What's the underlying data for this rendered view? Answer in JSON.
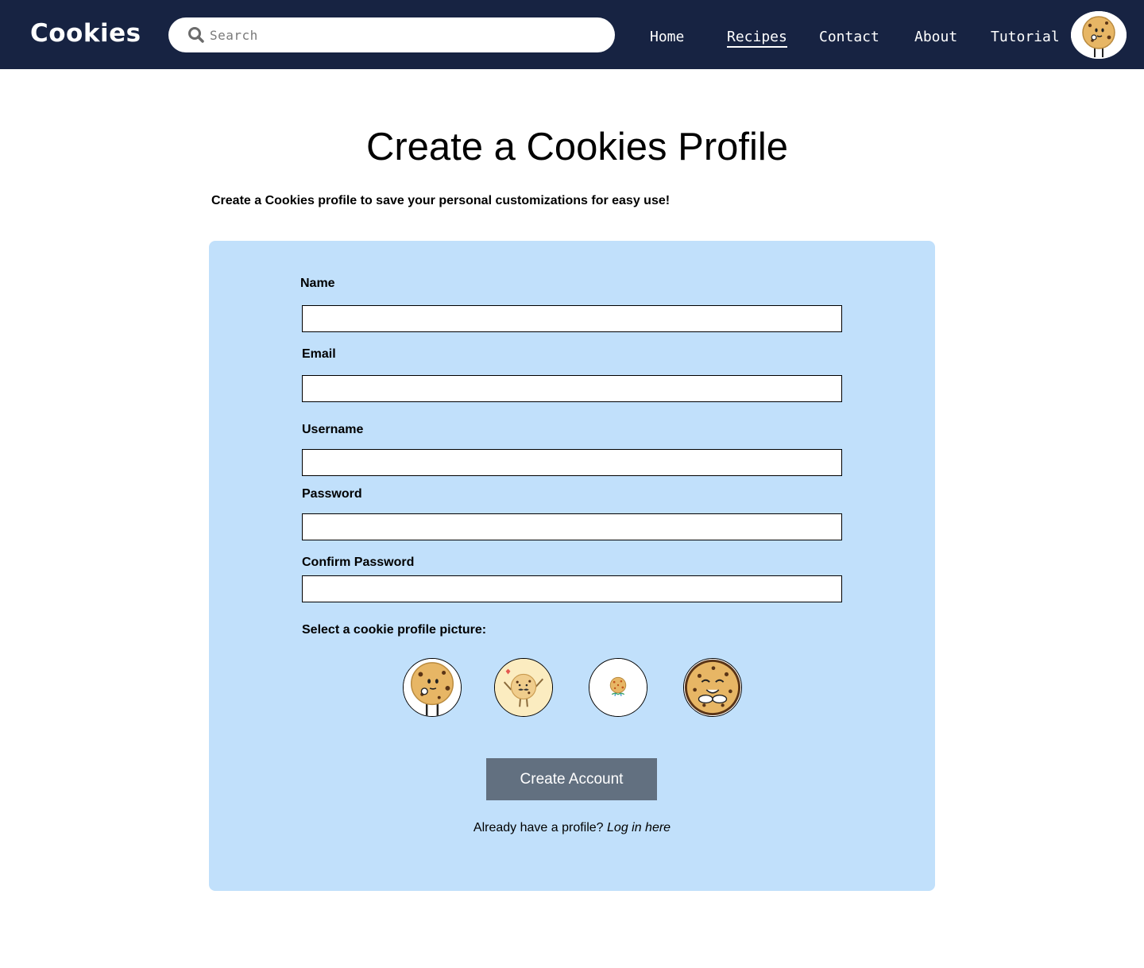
{
  "header": {
    "logo": "Cookies",
    "search": {
      "placeholder": "Search",
      "value": ""
    },
    "nav": [
      {
        "label": "Home"
      },
      {
        "label": "Recipes",
        "active": true
      },
      {
        "label": "Contact"
      },
      {
        "label": "About"
      },
      {
        "label": "Tutorial"
      }
    ],
    "avatar_icon": "cookie-character-icon"
  },
  "main": {
    "title": "Create a Cookies Profile",
    "intro": "Create a Cookies profile to save your personal customizations for easy use!",
    "form": {
      "fields": [
        {
          "label": "Name",
          "value": ""
        },
        {
          "label": "Email",
          "value": ""
        },
        {
          "label": "Username",
          "value": ""
        },
        {
          "label": "Password",
          "value": ""
        },
        {
          "label": "Confirm Password",
          "value": ""
        }
      ],
      "picture_prompt": "Select a cookie profile picture:",
      "pictures": [
        {
          "icon": "cookie-thinking-icon"
        },
        {
          "icon": "cookie-mustache-icon"
        },
        {
          "icon": "cookie-small-icon"
        },
        {
          "icon": "cookie-smiling-icon"
        }
      ],
      "submit_label": "Create Account",
      "login_prompt": "Already have a profile?",
      "login_link": "Log in here"
    }
  },
  "colors": {
    "header_bg": "#172342",
    "card_bg": "#c1e0fb",
    "button_bg": "#627080",
    "cookie": "#e7b665",
    "chip": "#5a3416"
  }
}
